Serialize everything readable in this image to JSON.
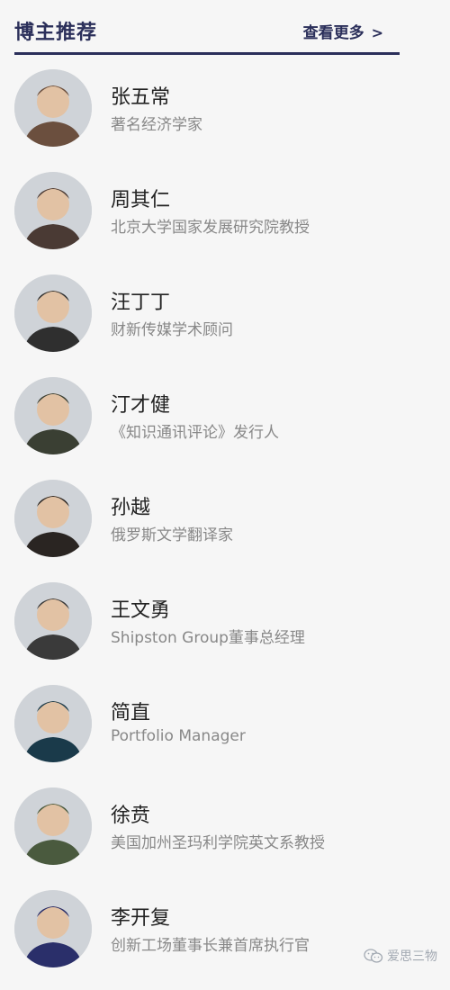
{
  "header": {
    "title": "博主推荐",
    "more_label": "查看更多",
    "more_chevron": ">"
  },
  "bloggers": [
    {
      "name": "张五常",
      "title": "著名经济学家",
      "avatar_color": "#6b4f3e"
    },
    {
      "name": "周其仁",
      "title": "北京大学国家发展研究院教授",
      "avatar_color": "#4a3a34"
    },
    {
      "name": "汪丁丁",
      "title": "财新传媒学术顾问",
      "avatar_color": "#2f2f2f"
    },
    {
      "name": "汀才健",
      "title": "《知识通讯评论》发行人",
      "avatar_color": "#3a3f33"
    },
    {
      "name": "孙越",
      "title": "俄罗斯文学翻译家",
      "avatar_color": "#2a2522"
    },
    {
      "name": "王文勇",
      "title": "Shipston Group董事总经理",
      "avatar_color": "#3a3a3a"
    },
    {
      "name": "简直",
      "title": "Portfolio Manager",
      "avatar_color": "#1a3a4a"
    },
    {
      "name": "徐贲",
      "title": "美国加州圣玛利学院英文系教授",
      "avatar_color": "#4a5a3e"
    },
    {
      "name": "李开复",
      "title": "创新工场董事长兼首席执行官",
      "avatar_color": "#2a2f6a"
    }
  ],
  "watermark": {
    "text": "爱思三物"
  },
  "colors": {
    "accent": "#2b2f5a",
    "name_text": "#222222",
    "subtitle_text": "#888888",
    "background": "#f6f6f6"
  }
}
